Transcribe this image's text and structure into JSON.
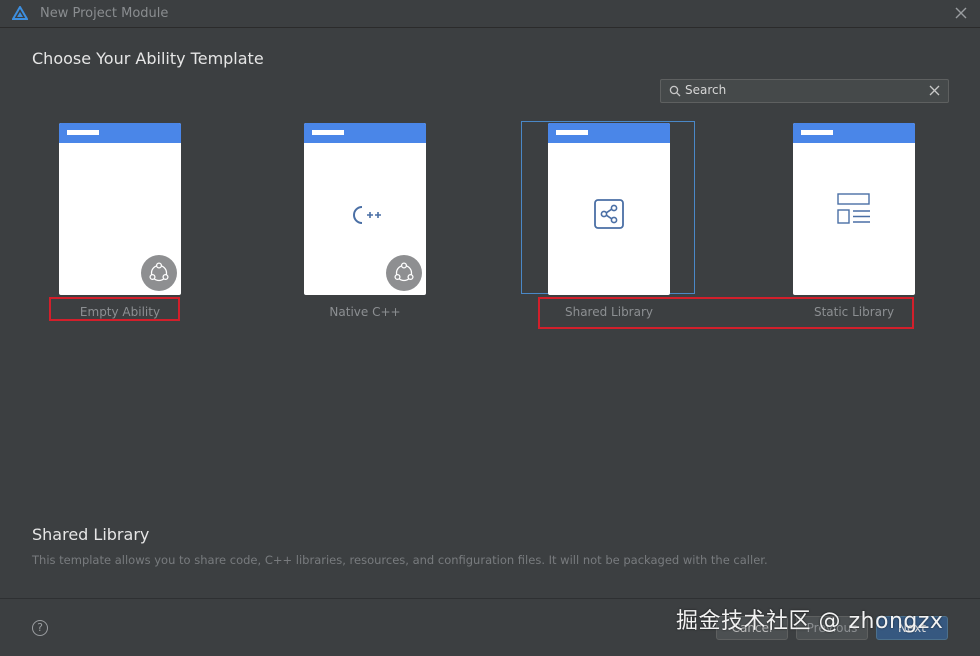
{
  "window": {
    "title": "New Project Module"
  },
  "page": {
    "title": "Choose Your Ability Template"
  },
  "search": {
    "placeholder": "Search"
  },
  "templates": [
    {
      "label": "Empty Ability",
      "icon": "ability-badge-icon",
      "selected": false
    },
    {
      "label": "Native C++",
      "icon": "cpp-icon",
      "selected": false
    },
    {
      "label": "Shared Library",
      "icon": "shared-library-icon",
      "selected": true
    },
    {
      "label": "Static Library",
      "icon": "static-library-icon",
      "selected": false
    }
  ],
  "description": {
    "title": "Shared Library",
    "text": "This template allows you to share code, C++ libraries, resources, and configuration files. It will not be packaged with the caller."
  },
  "footer": {
    "cancel_label": "Cancel",
    "previous_label": "Previous",
    "next_label": "Next"
  },
  "watermark": {
    "text": "掘金技术社区 @ zhongzx"
  },
  "colors": {
    "accent": "#4a86e8",
    "selection": "#4a88c7",
    "annotation": "#d21f2b",
    "background": "#3c3f41"
  }
}
